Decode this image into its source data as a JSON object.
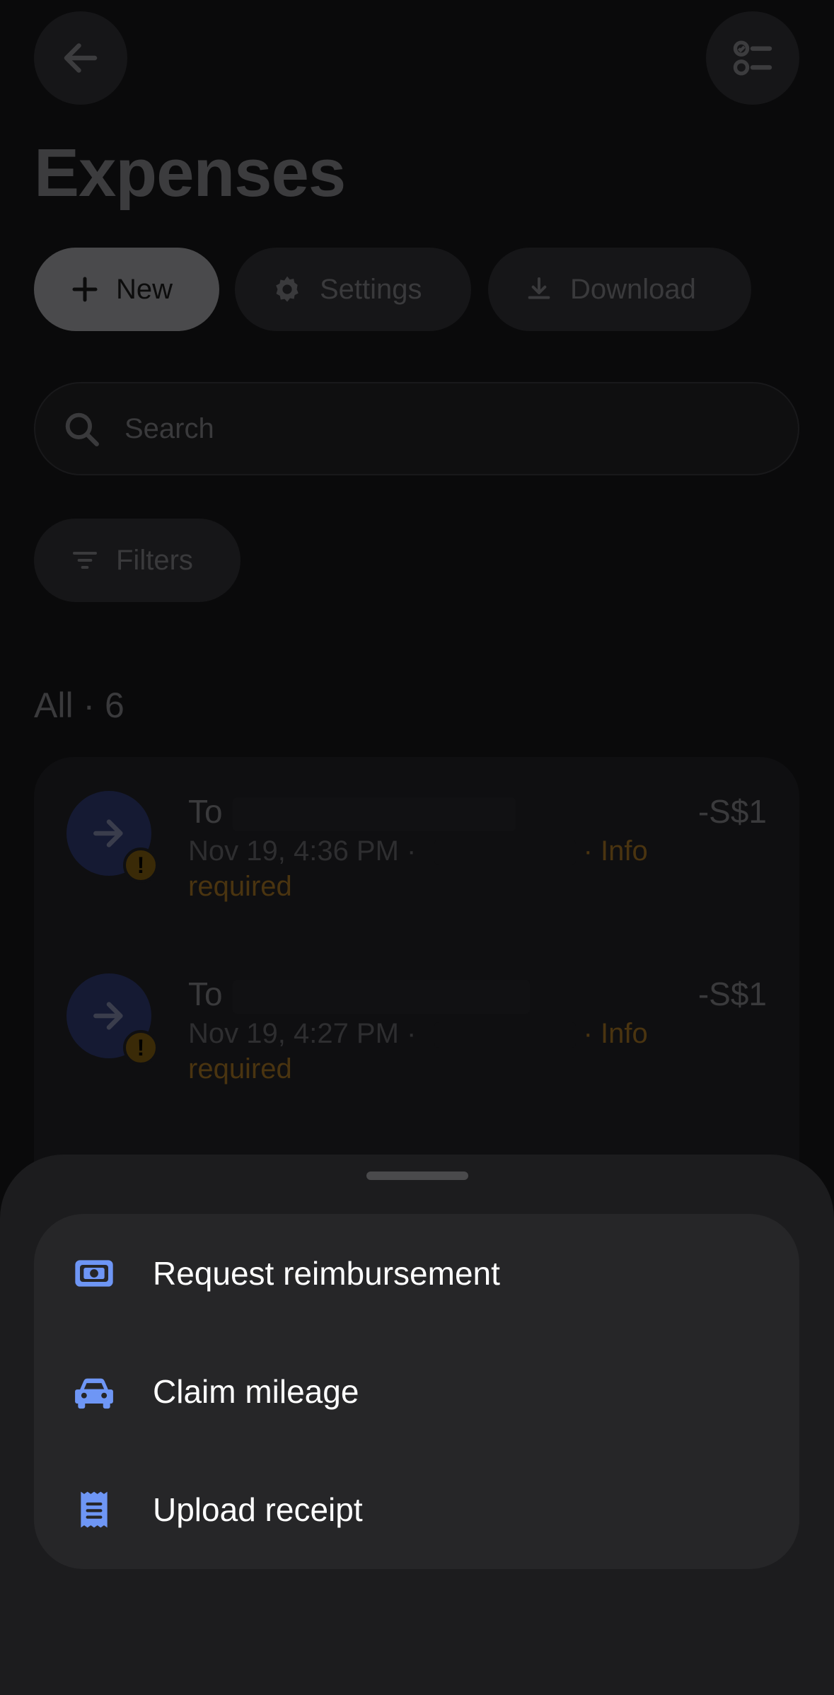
{
  "header": {
    "title": "Expenses",
    "back_icon": "arrow-left-icon",
    "tasks_icon": "checklist-icon"
  },
  "actions": {
    "new_label": "New",
    "settings_label": "Settings",
    "download_label": "Download"
  },
  "search": {
    "placeholder": "Search"
  },
  "filters": {
    "label": "Filters"
  },
  "list": {
    "count_label": "All · 6",
    "transactions": [
      {
        "title": "To",
        "amount": "-S$1",
        "time": "Nov 19, 4:36 PM ·",
        "status": "· Info required"
      },
      {
        "title": "To",
        "amount": "-S$1",
        "time": "Nov 19, 4:27 PM ·",
        "status": "· Info required"
      }
    ]
  },
  "sheet": {
    "items": [
      {
        "label": "Request reimbursement",
        "icon": "cash-icon"
      },
      {
        "label": "Claim mileage",
        "icon": "car-icon"
      },
      {
        "label": "Upload receipt",
        "icon": "receipt-icon"
      }
    ]
  },
  "colors": {
    "accent": "#6e96f5",
    "warning": "#f0a010"
  }
}
